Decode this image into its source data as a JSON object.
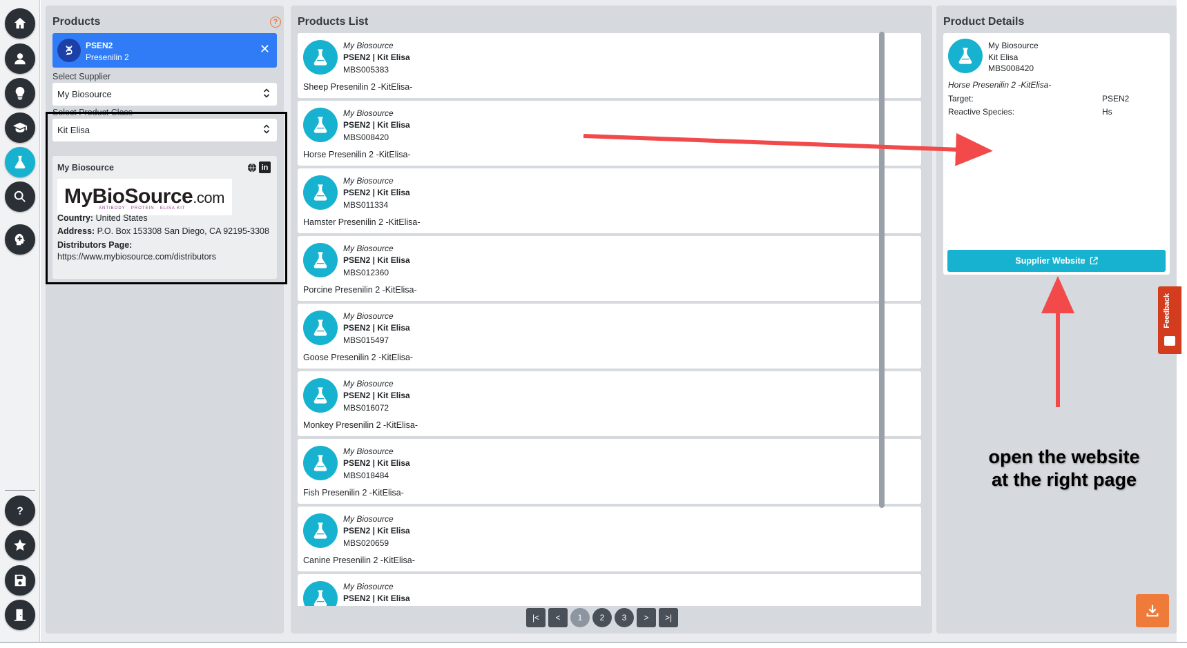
{
  "rail": {
    "items": [
      "home-icon",
      "user-icon",
      "lightbulb-icon",
      "graduation-cap-icon",
      "flask-icon",
      "search-icon",
      "brain-icon"
    ],
    "bottom_items": [
      "help-icon",
      "star-icon",
      "save-icon",
      "exit-door-icon"
    ],
    "active_color": "#17b2cf"
  },
  "products_panel": {
    "title": "Products",
    "help": "?",
    "gene": {
      "symbol": "PSEN2",
      "name": "Presenilin 2",
      "close": "✕"
    },
    "supplier_label": "Select Supplier",
    "supplier_value": "My Biosource",
    "class_label": "Select Product Class",
    "class_value": "Kit Elisa",
    "supplier_card": {
      "name": "My Biosource",
      "logo_main": "MyBioSource",
      "logo_com": ".com",
      "logo_tag": "ANTIBODY · PROTEIN · ELISA KIT",
      "linkedin": "in",
      "country_label": "Country:",
      "country": "United States",
      "address_label": "Address:",
      "address": "P.O. Box 153308 San Diego, CA 92195-3308",
      "distributors_label": "Distributors Page:",
      "distributors_url": "https://www.mybiosource.com/distributors"
    }
  },
  "products_list": {
    "title": "Products List",
    "items": [
      {
        "supplier": "My Biosource",
        "title": "PSEN2 | Kit Elisa",
        "code": "MBS005383",
        "desc": "Sheep Presenilin 2 -KitElisa-"
      },
      {
        "supplier": "My Biosource",
        "title": "PSEN2 | Kit Elisa",
        "code": "MBS008420",
        "desc": "Horse Presenilin 2 -KitElisa-"
      },
      {
        "supplier": "My Biosource",
        "title": "PSEN2 | Kit Elisa",
        "code": "MBS011334",
        "desc": "Hamster Presenilin 2 -KitElisa-"
      },
      {
        "supplier": "My Biosource",
        "title": "PSEN2 | Kit Elisa",
        "code": "MBS012360",
        "desc": "Porcine Presenilin 2 -KitElisa-"
      },
      {
        "supplier": "My Biosource",
        "title": "PSEN2 | Kit Elisa",
        "code": "MBS015497",
        "desc": "Goose Presenilin 2 -KitElisa-"
      },
      {
        "supplier": "My Biosource",
        "title": "PSEN2 | Kit Elisa",
        "code": "MBS016072",
        "desc": "Monkey Presenilin 2 -KitElisa-"
      },
      {
        "supplier": "My Biosource",
        "title": "PSEN2 | Kit Elisa",
        "code": "MBS018484",
        "desc": "Fish Presenilin 2 -KitElisa-"
      },
      {
        "supplier": "My Biosource",
        "title": "PSEN2 | Kit Elisa",
        "code": "MBS020659",
        "desc": "Canine Presenilin 2 -KitElisa-"
      },
      {
        "supplier": "My Biosource",
        "title": "PSEN2 | Kit Elisa",
        "code": "",
        "desc": ""
      }
    ],
    "pager": {
      "first": "|<",
      "prev": "<",
      "pages": [
        "1",
        "2",
        "3"
      ],
      "current": "1",
      "next": ">",
      "last": ">|"
    }
  },
  "details": {
    "title": "Product Details",
    "supplier": "My Biosource",
    "class": "Kit Elisa",
    "code": "MBS008420",
    "desc": "Horse Presenilin 2 -KitElisa-",
    "target_label": "Target:",
    "target": "PSEN2",
    "species_label": "Reactive Species:",
    "species": "Hs",
    "website_button": "Supplier Website"
  },
  "annotation": {
    "line1": "open the website",
    "line2": "at the right page",
    "arrow_color": "#f24a4a"
  },
  "feedback": {
    "label": "Feedback"
  },
  "colors": {
    "accent": "#17b2cf",
    "chip": "#2f7cf6",
    "download": "#ef7b3a",
    "feedback": "#d33c1c"
  }
}
